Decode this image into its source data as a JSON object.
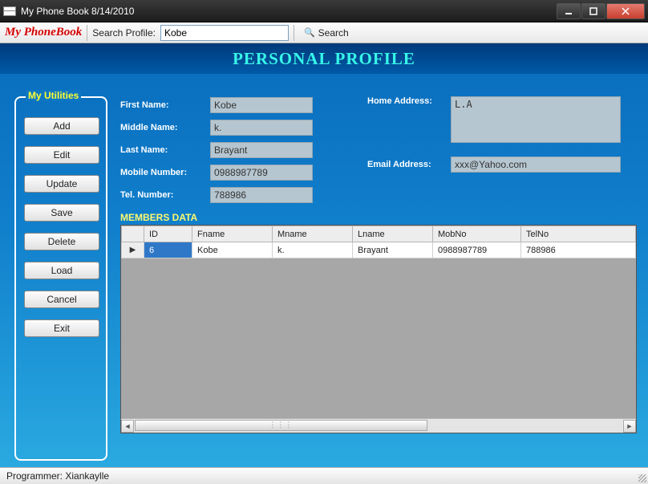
{
  "window": {
    "title": "My Phone Book 8/14/2010"
  },
  "toolbar": {
    "brand": "My PhoneBook",
    "search_label": "Search Profile:",
    "search_value": "Kobe",
    "search_button": "Search"
  },
  "header": {
    "title": "PERSONAL PROFILE"
  },
  "sidebar": {
    "group_label": "My Utilities",
    "buttons": {
      "add": "Add",
      "edit": "Edit",
      "update": "Update",
      "save": "Save",
      "delete": "Delete",
      "load": "Load",
      "cancel": "Cancel",
      "exit": "Exit"
    }
  },
  "form": {
    "labels": {
      "first_name": "First Name:",
      "middle_name": "Middle Name:",
      "last_name": "Last Name:",
      "mobile_number": "Mobile Number:",
      "tel_number": "Tel. Number:",
      "home_address": "Home Address:",
      "email_address": "Email Address:"
    },
    "values": {
      "first_name": "Kobe",
      "middle_name": "k.",
      "last_name": "Brayant",
      "mobile_number": "0988987789",
      "tel_number": "788986",
      "home_address": "L.A",
      "email_address": "xxx@Yahoo.com"
    }
  },
  "grid": {
    "label": "MEMBERS DATA",
    "columns": {
      "id": "ID",
      "fname": "Fname",
      "mname": "Mname",
      "lname": "Lname",
      "mobno": "MobNo",
      "telno": "TelNo"
    },
    "rows": [
      {
        "id": "6",
        "fname": "Kobe",
        "mname": "k.",
        "lname": "Brayant",
        "mobno": "0988987789",
        "telno": "788986"
      }
    ]
  },
  "statusbar": {
    "text": "Programmer: Xiankaylle"
  }
}
